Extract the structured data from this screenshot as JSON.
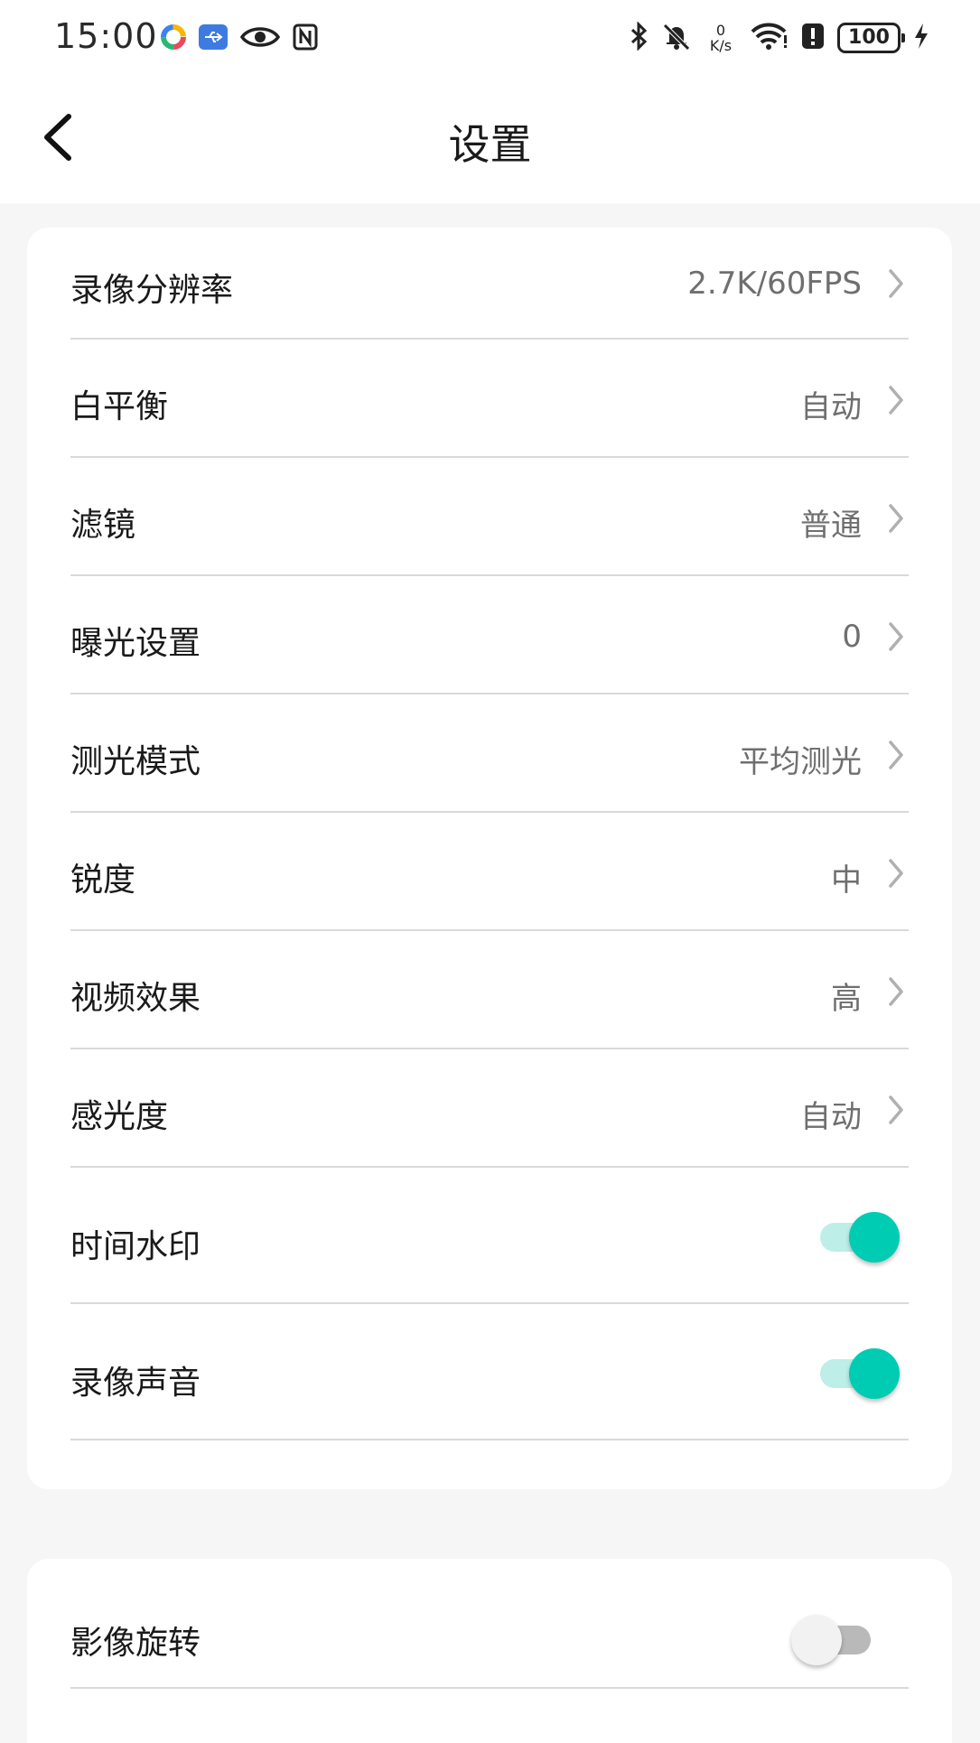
{
  "status_bar": {
    "time": "15:00",
    "net_speed_value": "0",
    "net_speed_unit": "K/s",
    "battery": "100"
  },
  "header": {
    "title": "设置"
  },
  "settings": {
    "rows": [
      {
        "label": "录像分辨率",
        "value": "2.7K/60FPS"
      },
      {
        "label": "白平衡",
        "value": "自动"
      },
      {
        "label": "滤镜",
        "value": "普通"
      },
      {
        "label": "曝光设置",
        "value": "0"
      },
      {
        "label": "测光模式",
        "value": "平均测光"
      },
      {
        "label": "锐度",
        "value": "中"
      },
      {
        "label": "视频效果",
        "value": "高"
      },
      {
        "label": "感光度",
        "value": "自动"
      }
    ],
    "toggles": [
      {
        "label": "时间水印",
        "state": "on"
      },
      {
        "label": "录像声音",
        "state": "on"
      }
    ]
  },
  "settings_2": {
    "toggles": [
      {
        "label": "影像旋转",
        "state": "off"
      }
    ]
  },
  "colors": {
    "accent": "#00ccb4",
    "accent_track": "#bdeee8",
    "off_track": "#b9b9b9",
    "background": "#f6f6f6"
  }
}
